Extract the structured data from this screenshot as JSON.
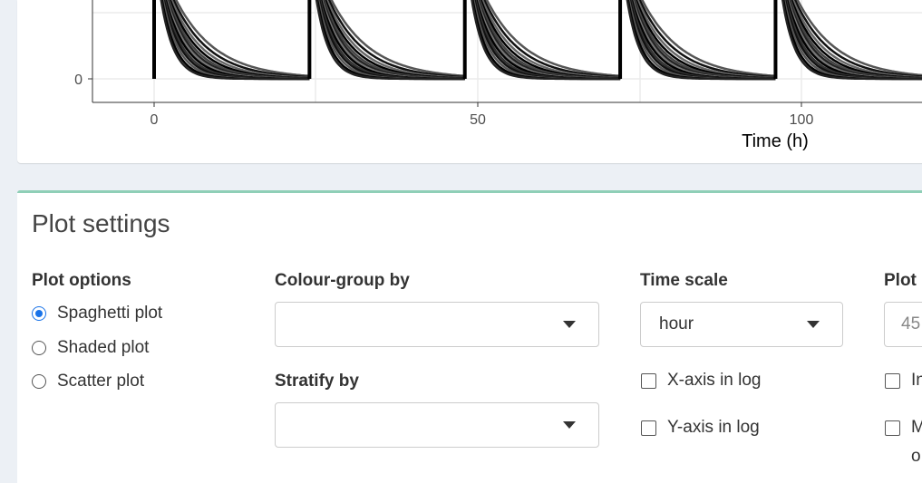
{
  "plot": {
    "x_axis_title": "Time (h)",
    "x_ticks": [
      "0",
      "50",
      "100"
    ],
    "y_ticks": [
      "0"
    ]
  },
  "settings": {
    "title": "Plot settings",
    "plot_options": {
      "label": "Plot options",
      "options": [
        "Spaghetti plot",
        "Shaded plot",
        "Scatter plot"
      ],
      "selected": "Spaghetti plot"
    },
    "colour_group": {
      "label": "Colour-group by",
      "value": ""
    },
    "stratify": {
      "label": "Stratify by",
      "value": ""
    },
    "time_scale": {
      "label": "Time scale",
      "value": "hour"
    },
    "x_log": {
      "label": "X-axis in log",
      "checked": false
    },
    "y_log": {
      "label": "Y-axis in log",
      "checked": false
    },
    "plot_col": {
      "label": "Plot",
      "value": "45",
      "check1": "In",
      "check2": "M",
      "check2_line2": "o"
    }
  },
  "colors": {
    "accent_border": "#8fcfb7",
    "radio_selected": "#1a73e8"
  }
}
